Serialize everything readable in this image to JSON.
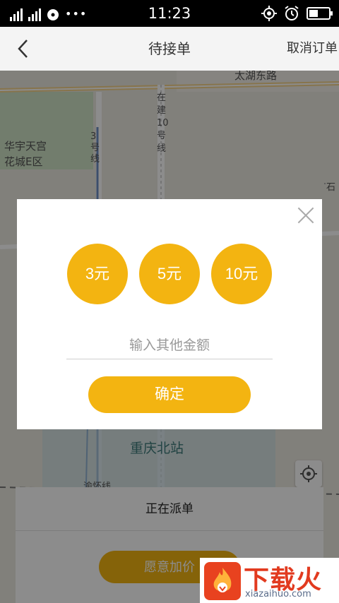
{
  "status_bar": {
    "time": "11:23",
    "left_icons": [
      "signal-1-icon",
      "signal-2-icon",
      "media-icon",
      "more-dots-icon"
    ],
    "right_icons": [
      "gps-icon",
      "alarm-icon",
      "battery-icon"
    ],
    "more_dots": "•••",
    "battery_level": 0.45
  },
  "header": {
    "title": "待接单",
    "cancel_label": "取消订单"
  },
  "map": {
    "labels": {
      "road_top": "太湖东路",
      "district_1": "华宇天宫",
      "district_2": "花城E区",
      "line_3": "3号线",
      "line_10": "在建10号线",
      "edge_right": "石"
    },
    "station": "重庆北站",
    "rail_label": "渝怀线"
  },
  "modal": {
    "amounts": [
      "3元",
      "5元",
      "10元"
    ],
    "input_placeholder": "输入其他金额",
    "confirm_label": "确定"
  },
  "panel": {
    "status": "正在派单",
    "raise_label": "愿意加价"
  },
  "watermark": {
    "cn": "下载火",
    "en": "xiazaihuo.com"
  },
  "colors": {
    "accent": "#f3b411",
    "overlay": "rgba(0,0,0,0.45)",
    "logo_red": "#e23a1f"
  }
}
